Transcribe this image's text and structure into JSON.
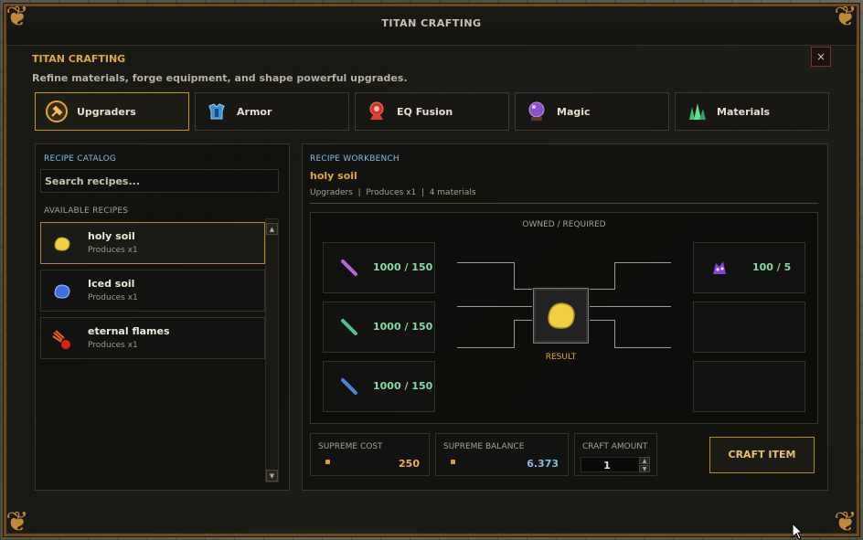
{
  "window": {
    "title": "TITAN CRAFTING"
  },
  "header": {
    "title": "TITAN CRAFTING",
    "subtitle": "Refine materials, forge equipment, and shape powerful upgrades.",
    "close_label": "×"
  },
  "tabs": [
    {
      "label": "Upgraders",
      "icon": "hammer-icon",
      "active": true
    },
    {
      "label": "Armor",
      "icon": "armor-icon",
      "active": false
    },
    {
      "label": "EQ Fusion",
      "icon": "fusion-icon",
      "active": false
    },
    {
      "label": "Magic",
      "icon": "crystal-ball-icon",
      "active": false
    },
    {
      "label": "Materials",
      "icon": "crystals-icon",
      "active": false
    }
  ],
  "catalog": {
    "label": "RECIPE CATALOG",
    "search_placeholder": "Search recipes...",
    "available_label": "AVAILABLE RECIPES",
    "recipes": [
      {
        "name": "holy soil",
        "produces": "Produces x1",
        "icon": "holy-soil-icon",
        "selected": true
      },
      {
        "name": "Iced soil",
        "produces": "Produces x1",
        "icon": "iced-soil-icon",
        "selected": false
      },
      {
        "name": "eternal flames",
        "produces": "Produces x1",
        "icon": "eternal-flames-icon",
        "selected": false
      }
    ]
  },
  "workbench": {
    "label": "RECIPE WORKBENCH",
    "recipe_name": "holy soil",
    "meta": [
      "Upgraders",
      "Produces x1",
      "4 materials"
    ],
    "meta_sep": "|",
    "owned_required_label": "OWNED / REQUIRED",
    "left_materials": [
      {
        "icon": "purple-rod-icon",
        "value": "1000 / 150"
      },
      {
        "icon": "green-rod-icon",
        "value": "1000 / 150"
      },
      {
        "icon": "blue-rod-icon",
        "value": "1000 / 150"
      }
    ],
    "right_materials": [
      {
        "icon": "purple-creature-icon",
        "value": "100 / 5"
      }
    ],
    "result_label": "RESULT",
    "result_icon": "holy-soil-icon",
    "supreme_cost_label": "SUPREME COST",
    "supreme_cost_value": "250",
    "supreme_balance_label": "SUPREME BALANCE",
    "supreme_balance_value": "6.373",
    "craft_amount_label": "CRAFT AMOUNT",
    "craft_amount_value": "1",
    "craft_button": "CRAFT ITEM"
  },
  "colors": {
    "accent": "#e0a838",
    "owned_green": "#8ad8a4",
    "label_blue": "#88bce0",
    "frame": "#6b4a22"
  }
}
